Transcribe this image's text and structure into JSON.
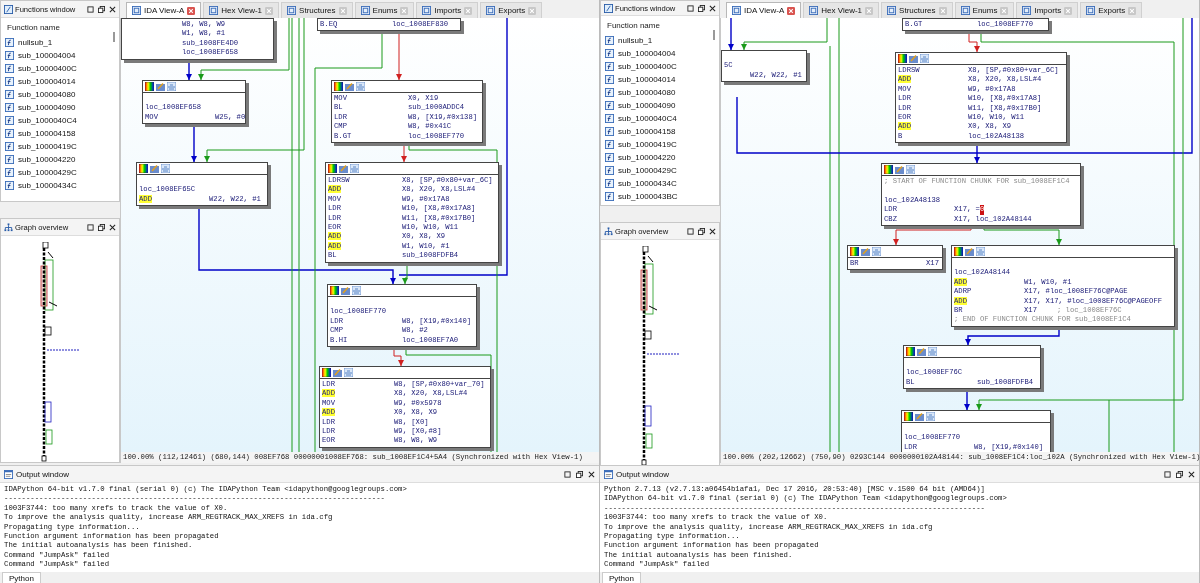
{
  "panes": [
    {
      "functions_window": {
        "title": "Functions window",
        "column": "Function name",
        "items": [
          "nullsub_1",
          "sub_100004004",
          "sub_10000400C",
          "sub_100004014",
          "sub_100004080",
          "sub_100004090",
          "sub_1000040C4",
          "sub_100004158",
          "sub_10000419C",
          "sub_100004220",
          "sub_10000429C",
          "sub_10000434C"
        ]
      },
      "graph_overview": {
        "title": "Graph overview"
      },
      "tabs": [
        {
          "label": "IDA View-A",
          "selected": true
        },
        {
          "label": "Hex View-1",
          "selected": false
        },
        {
          "label": "Structures",
          "selected": false
        },
        {
          "label": "Enums",
          "selected": false
        },
        {
          "label": "Imports",
          "selected": false
        },
        {
          "label": "Exports",
          "selected": false
        }
      ],
      "blocks": [
        {
          "toolbar": false,
          "lines": [
            {
              "kind": "insn",
              "args": "W8, W8, W9"
            },
            {
              "kind": "insn",
              "args": "W1, W8, #1"
            },
            {
              "kind": "insn",
              "args": "sub_1008FE4D0"
            },
            {
              "kind": "insn",
              "args": "loc_1008EF658"
            }
          ]
        },
        {
          "toolbar": true,
          "lines": [
            {
              "kind": "blank"
            },
            {
              "kind": "label",
              "text": "loc_1008EF658"
            },
            {
              "kind": "insn",
              "op": "MOV",
              "args": "W25, #0",
              "highlighted": false
            }
          ]
        },
        {
          "toolbar": true,
          "lines": [
            {
              "kind": "blank"
            },
            {
              "kind": "label",
              "text": "loc_1008EF65C"
            },
            {
              "kind": "insn",
              "op": "ADD",
              "args": "W22, W22, #1",
              "highlighted": true
            }
          ]
        },
        {
          "toolbar": false,
          "lines": [
            {
              "kind": "insn",
              "op": "B.EQ",
              "args": "loc_1008EF830",
              "highlighted": false
            }
          ]
        },
        {
          "toolbar": true,
          "lines": [
            {
              "kind": "insn",
              "op": "MOV",
              "args": "X0, X19",
              "highlighted": false
            },
            {
              "kind": "insn",
              "op": "BL",
              "args": "sub_1000ADDC4",
              "highlighted": false
            },
            {
              "kind": "insn",
              "op": "LDR",
              "args": "W8, [X19,#0x138]",
              "highlighted": false
            },
            {
              "kind": "insn",
              "op": "CMP",
              "args": "W8, #0x41C",
              "highlighted": false
            },
            {
              "kind": "insn",
              "op": "B.GT",
              "args": "loc_1008EF770",
              "highlighted": false
            }
          ]
        },
        {
          "toolbar": true,
          "lines": [
            {
              "kind": "insn",
              "op": "LDRSW",
              "args": "X8, [SP,#0x80+var_6C]",
              "highlighted": false
            },
            {
              "kind": "insn",
              "op": "ADD",
              "args": "X8, X20, X8,LSL#4",
              "highlighted": true
            },
            {
              "kind": "insn",
              "op": "MOV",
              "args": "W9, #0x17A8",
              "highlighted": false
            },
            {
              "kind": "insn",
              "op": "LDR",
              "args": "W10, [X8,#0x17A8]",
              "highlighted": false
            },
            {
              "kind": "insn",
              "op": "LDR",
              "args": "W11, [X8,#0x17B0]",
              "highlighted": false
            },
            {
              "kind": "insn",
              "op": "EOR",
              "args": "W10, W10, W11",
              "highlighted": false
            },
            {
              "kind": "insn",
              "op": "ADD",
              "args": "X0, X8, X9",
              "highlighted": true
            },
            {
              "kind": "insn",
              "op": "ADD",
              "args": "W1, W10, #1",
              "highlighted": true
            },
            {
              "kind": "insn",
              "op": "BL",
              "args": "sub_1008FDFB4",
              "highlighted": false
            }
          ]
        },
        {
          "toolbar": true,
          "lines": [
            {
              "kind": "blank"
            },
            {
              "kind": "label",
              "text": "loc_1008EF770"
            },
            {
              "kind": "insn",
              "op": "LDR",
              "args": "W8, [X19,#0x140]",
              "highlighted": false
            },
            {
              "kind": "insn",
              "op": "CMP",
              "args": "W8, #2",
              "highlighted": false
            },
            {
              "kind": "insn",
              "op": "B.HI",
              "args": "loc_1008EF7A0",
              "highlighted": false
            }
          ]
        },
        {
          "toolbar": true,
          "lines": [
            {
              "kind": "insn",
              "op": "LDR",
              "args": "W8, [SP,#0x80+var_70]",
              "highlighted": false
            },
            {
              "kind": "insn",
              "op": "ADD",
              "args": "X8, X20, X8,LSL#4",
              "highlighted": true
            },
            {
              "kind": "insn",
              "op": "MOV",
              "args": "W9, #0x5978",
              "highlighted": false
            },
            {
              "kind": "insn",
              "op": "ADD",
              "args": "X0, X8, X9",
              "highlighted": true
            },
            {
              "kind": "insn",
              "op": "LDR",
              "args": "W8, [X0]",
              "highlighted": false
            },
            {
              "kind": "insn",
              "op": "LDR",
              "args": "W9, [X0,#8]",
              "highlighted": false
            },
            {
              "kind": "insn",
              "op": "EOR",
              "args": "W8, W8, W9",
              "highlighted": false
            }
          ]
        }
      ],
      "status": "100.00% (112,12461) (680,144) 008EF768 00000001008EF768: sub_1008EF1C4+5A4 (Synchronized with Hex View-1)",
      "output": {
        "title": "Output window",
        "lines": [
          "IDAPython 64-bit v1.7.0 final (serial 0) (c) The IDAPython Team <idapython@googlegroups.com>",
          "---------------------------------------------------------------------------------------",
          "1003F3744: too many xrefs to track the value of X0.",
          "To improve the analysis quality, increase ARM_REGTRACK_MAX_XREFS in ida.cfg",
          "Propagating type information...",
          "Function argument information has been propagated",
          "The initial autoanalysis has been finished.",
          "Command \"JumpAsk\" failed",
          "Command \"JumpAsk\" failed"
        ],
        "tab": "Python"
      }
    },
    {
      "functions_window": {
        "title": "Functions window",
        "column": "Function name",
        "items": [
          "nullsub_1",
          "sub_100004004",
          "sub_10000400C",
          "sub_100004014",
          "sub_100004080",
          "sub_100004090",
          "sub_1000040C4",
          "sub_100004158",
          "sub_10000419C",
          "sub_100004220",
          "sub_10000429C",
          "sub_10000434C",
          "sub_1000043BC"
        ]
      },
      "graph_overview": {
        "title": "Graph overview"
      },
      "tabs": [
        {
          "label": "IDA View-A",
          "selected": true
        },
        {
          "label": "Hex View-1",
          "selected": false
        },
        {
          "label": "Structures",
          "selected": false
        },
        {
          "label": "Enums",
          "selected": false
        },
        {
          "label": "Imports",
          "selected": false
        },
        {
          "label": "Exports",
          "selected": false
        }
      ],
      "blocks": [
        {
          "toolbar": false,
          "lines": [
            {
              "kind": "insn",
              "op": "B.GT",
              "args": "loc_1008EF770",
              "highlighted": false
            }
          ]
        },
        {
          "toolbar": false,
          "lines": [
            {
              "kind": "blank"
            },
            {
              "kind": "label",
              "text": "5C"
            },
            {
              "kind": "insn",
              "args": "W22, W22, #1"
            }
          ]
        },
        {
          "toolbar": true,
          "lines": [
            {
              "kind": "insn",
              "op": "LDRSW",
              "args": "X8, [SP,#0x80+var_6C]",
              "highlighted": false
            },
            {
              "kind": "insn",
              "op": "ADD",
              "args": "X8, X20, X8,LSL#4",
              "highlighted": true
            },
            {
              "kind": "insn",
              "op": "MOV",
              "args": "W9, #0x17A8",
              "highlighted": false
            },
            {
              "kind": "insn",
              "op": "LDR",
              "args": "W10, [X8,#0x17A8]",
              "highlighted": false
            },
            {
              "kind": "insn",
              "op": "LDR",
              "args": "W11, [X8,#0x17B0]",
              "highlighted": false
            },
            {
              "kind": "insn",
              "op": "EOR",
              "args": "W10, W10, W11",
              "highlighted": false
            },
            {
              "kind": "insn",
              "op": "ADD",
              "args": "X0, X8, X9",
              "highlighted": true
            },
            {
              "kind": "insn",
              "op": "B",
              "args": "loc_102A48138",
              "highlighted": false
            }
          ]
        },
        {
          "toolbar": true,
          "lines": [
            {
              "kind": "comment",
              "text": "; START OF FUNCTION CHUNK FOR sub_1008EF1C4"
            },
            {
              "kind": "blank"
            },
            {
              "kind": "label",
              "text": "loc_102A48138"
            },
            {
              "kind": "insn",
              "op": "LDR",
              "args": "X17, =",
              "flagged": "0",
              "highlighted": false
            },
            {
              "kind": "insn",
              "op": "CBZ",
              "args": "X17, loc_102A48144",
              "highlighted": false
            }
          ]
        },
        {
          "toolbar": true,
          "lines": [
            {
              "kind": "insn",
              "op": "BR",
              "args": "X17",
              "highlighted": false
            }
          ]
        },
        {
          "toolbar": true,
          "lines": [
            {
              "kind": "blank"
            },
            {
              "kind": "label",
              "text": "loc_102A48144"
            },
            {
              "kind": "insn",
              "op": "ADD",
              "args": "W1, W10, #1",
              "highlighted": true
            },
            {
              "kind": "insn",
              "op": "ADRP",
              "args": "X17, #loc_1008EF76C@PAGE",
              "highlighted": false
            },
            {
              "kind": "insn",
              "op": "ADD",
              "args": "X17, X17, #loc_1008EF76C@PAGEOFF",
              "highlighted": true
            },
            {
              "kind": "insn",
              "op": "BR",
              "args": "X17",
              "comment": "; loc_1008EF76C",
              "highlighted": false
            },
            {
              "kind": "comment",
              "text": "; END OF FUNCTION CHUNK FOR sub_1008EF1C4"
            }
          ]
        },
        {
          "toolbar": true,
          "lines": [
            {
              "kind": "blank"
            },
            {
              "kind": "label",
              "text": "loc_1008EF76C"
            },
            {
              "kind": "insn",
              "op": "BL",
              "args": "sub_1008FDFB4",
              "highlighted": false
            }
          ]
        },
        {
          "toolbar": true,
          "lines": [
            {
              "kind": "blank"
            },
            {
              "kind": "label",
              "text": "loc_1008EF770"
            },
            {
              "kind": "insn",
              "op": "LDR",
              "args": "W8, [X19,#0x140]",
              "highlighted": false
            }
          ]
        }
      ],
      "status": "100.00% (202,12662) (750,90) 0293C144 0000000102A48144: sub_1008EF1C4:loc_102A (Synchronized with Hex View-1)",
      "output": {
        "title": "Output window",
        "lines": [
          "Python 2.7.13 (v2.7.13:a06454b1afa1, Dec 17 2016, 20:53:40) [MSC v.1500 64 bit (AMD64)]",
          "IDAPython 64-bit v1.7.0 final (serial 0) (c) The IDAPython Team <idapython@googlegroups.com>",
          "---------------------------------------------------------------------------------------",
          "1003F3744: too many xrefs to track the value of X0.",
          "To improve the analysis quality, increase ARM_REGTRACK_MAX_XREFS in ida.cfg",
          "Propagating type information...",
          "Function argument information has been propagated",
          "The initial autoanalysis has been finished.",
          "Command \"JumpAsk\" failed"
        ],
        "tab": "Python"
      }
    }
  ]
}
